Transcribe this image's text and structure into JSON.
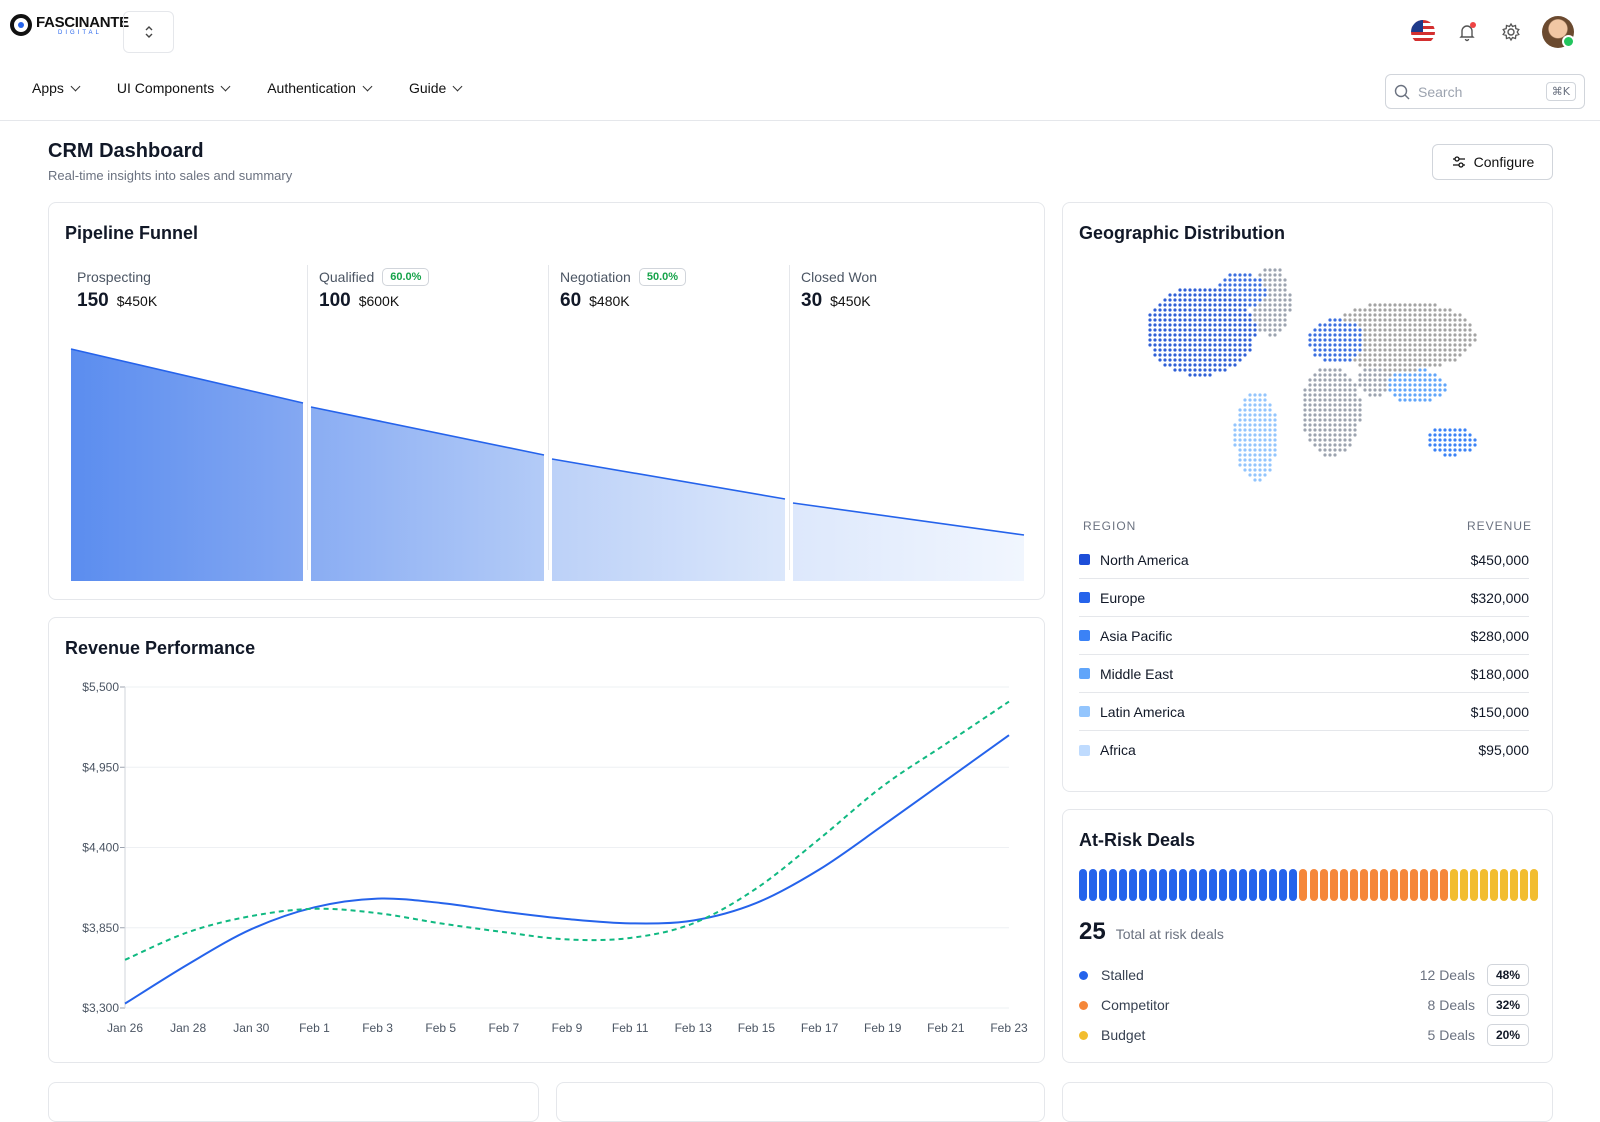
{
  "brand": {
    "name": "FASCINANTE",
    "tagline": "DIGITAL",
    "switcher_icon": "up-down-chevron-icon"
  },
  "nav": [
    {
      "label": "Apps"
    },
    {
      "label": "UI Components"
    },
    {
      "label": "Authentication"
    },
    {
      "label": "Guide"
    }
  ],
  "search": {
    "placeholder": "Search",
    "shortcut": "⌘K"
  },
  "header_icons": [
    "us-flag-icon",
    "bell-icon",
    "gear-icon",
    "avatar"
  ],
  "page": {
    "title": "CRM Dashboard",
    "subtitle": "Real-time insights into sales and summary",
    "configure_label": "Configure"
  },
  "pipeline": {
    "title": "Pipeline Funnel",
    "stages": [
      {
        "name": "Prospecting",
        "count": "150",
        "amount": "$450K",
        "badge": ""
      },
      {
        "name": "Qualified",
        "count": "100",
        "amount": "$600K",
        "badge": "60.0%"
      },
      {
        "name": "Negotiation",
        "count": "60",
        "amount": "$480K",
        "badge": "50.0%"
      },
      {
        "name": "Closed Won",
        "count": "30",
        "amount": "$450K",
        "badge": ""
      }
    ],
    "colors": {
      "line": "#2563eb",
      "fill": "#3b82f6"
    }
  },
  "revenue": {
    "title": "Revenue Performance"
  },
  "chart_data": {
    "type": "line",
    "title": "Revenue Performance",
    "x": [
      "Jan 26",
      "Jan 28",
      "Jan 30",
      "Feb 1",
      "Feb 3",
      "Feb 5",
      "Feb 7",
      "Feb 9",
      "Feb 11",
      "Feb 13",
      "Feb 15",
      "Feb 17",
      "Feb 19",
      "Feb 21",
      "Feb 23"
    ],
    "series": [
      {
        "values": [
          3330,
          3600,
          3840,
          3990,
          4050,
          4020,
          3960,
          3910,
          3880,
          3900,
          4020,
          4250,
          4550,
          4860,
          5170
        ],
        "color": "#2563eb",
        "style": "solid"
      },
      {
        "values": [
          3630,
          3820,
          3930,
          3980,
          3950,
          3880,
          3820,
          3770,
          3780,
          3880,
          4120,
          4460,
          4820,
          5110,
          5400
        ],
        "color": "#10b981",
        "style": "dashed"
      }
    ],
    "yticks": [
      "$3,300",
      "$3,850",
      "$4,400",
      "$4,950",
      "$5,500"
    ],
    "ylim": [
      3300,
      5500
    ],
    "grid": true
  },
  "geo": {
    "title": "Geographic Distribution",
    "col_region": "REGION",
    "col_revenue": "REVENUE",
    "rows": [
      {
        "region": "North America",
        "revenue": "$450,000",
        "color": "#1d4ed8"
      },
      {
        "region": "Europe",
        "revenue": "$320,000",
        "color": "#2563eb"
      },
      {
        "region": "Asia Pacific",
        "revenue": "$280,000",
        "color": "#3b82f6"
      },
      {
        "region": "Middle East",
        "revenue": "$180,000",
        "color": "#60a5fa"
      },
      {
        "region": "Latin America",
        "revenue": "$150,000",
        "color": "#93c5fd"
      },
      {
        "region": "Africa",
        "revenue": "$95,000",
        "color": "#bfdbfe"
      }
    ]
  },
  "risk": {
    "title": "At-Risk Deals",
    "total": "25",
    "total_label": "Total at risk deals",
    "bar_share": [
      0.48,
      0.32,
      0.2
    ],
    "rows": [
      {
        "name": "Stalled",
        "deals": "12 Deals",
        "pct": "48%",
        "color": "#2563eb"
      },
      {
        "name": "Competitor",
        "deals": "8 Deals",
        "pct": "32%",
        "color": "#f5873a"
      },
      {
        "name": "Budget",
        "deals": "5 Deals",
        "pct": "20%",
        "color": "#f2bd2f"
      }
    ]
  }
}
